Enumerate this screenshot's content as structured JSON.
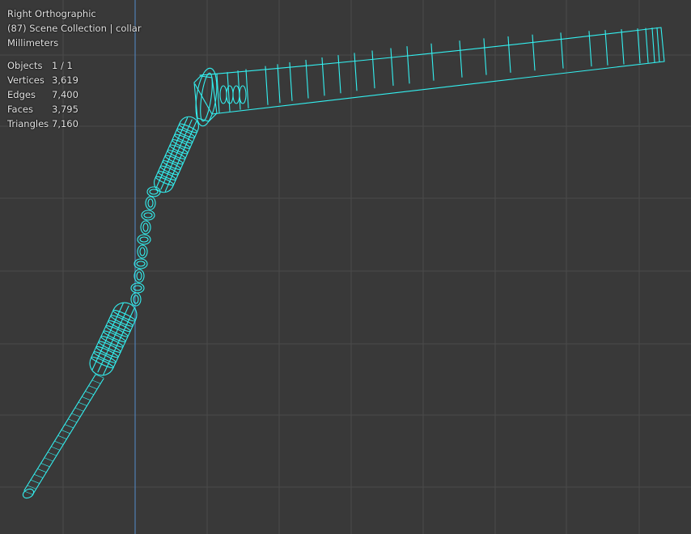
{
  "viewport": {
    "view_name": "Right Orthographic",
    "collection_line": "(87) Scene Collection | collar",
    "units": "Millimeters",
    "shading": "wireframe",
    "colors": {
      "background": "#393939",
      "grid_line": "#4a4a4a",
      "axis_line": "#4f7fb3",
      "wire": "#33f0f0"
    }
  },
  "stats": [
    {
      "label": "Objects",
      "value": "1 / 1"
    },
    {
      "label": "Vertices",
      "value": "3,619"
    },
    {
      "label": "Edges",
      "value": "7,400"
    },
    {
      "label": "Faces",
      "value": "3,795"
    },
    {
      "label": "Triangles",
      "value": "7,160"
    }
  ]
}
